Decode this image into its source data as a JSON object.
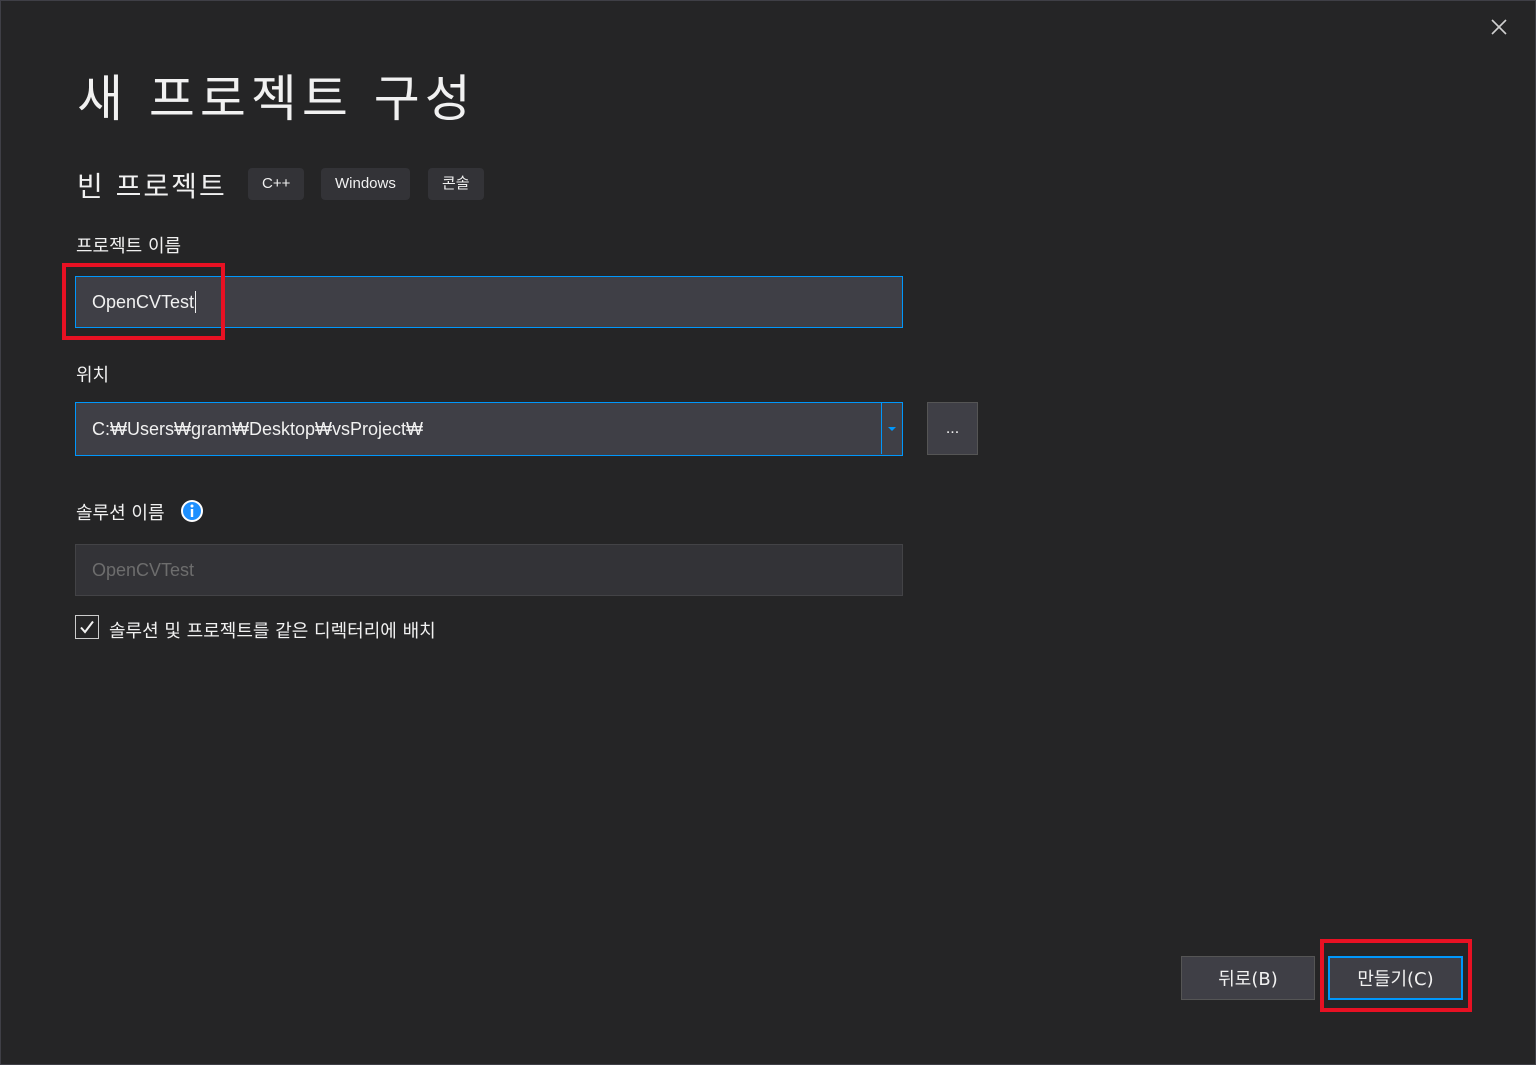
{
  "dialog": {
    "title": "새 프로젝트 구성",
    "template_name": "빈 프로젝트",
    "tags": [
      "C++",
      "Windows",
      "콘솔"
    ]
  },
  "project_name": {
    "label": "프로젝트 이름",
    "value": "OpenCVTest"
  },
  "location": {
    "label": "위치",
    "value": "C:₩Users₩gram₩Desktop₩vsProject₩",
    "browse_label": "..."
  },
  "solution_name": {
    "label": "솔루션 이름",
    "placeholder": "OpenCVTest"
  },
  "same_directory": {
    "label": "솔루션 및 프로젝트를 같은 디렉터리에 배치",
    "checked": true
  },
  "footer": {
    "back_label": "뒤로(B)",
    "create_label": "만들기(C)"
  },
  "colors": {
    "background": "#252526",
    "input_background": "#3f3f46",
    "accent": "#0097fb",
    "highlight": "#e81123"
  },
  "icons": [
    "close-icon",
    "chevron-down-icon",
    "info-icon",
    "checkmark-icon"
  ]
}
